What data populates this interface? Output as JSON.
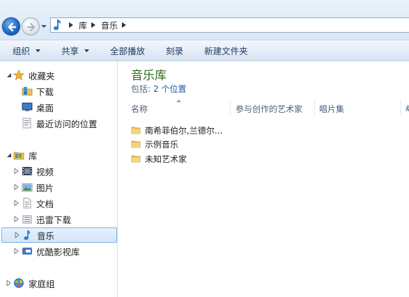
{
  "address": {
    "crumbs": [
      "库",
      "音乐"
    ]
  },
  "toolbar": {
    "organize": "组织",
    "share": "共享",
    "play_all": "全部播放",
    "burn": "刻录",
    "new_folder": "新建文件夹"
  },
  "nav": {
    "favorites": "收藏夹",
    "downloads": "下载",
    "desktop": "桌面",
    "recent": "最近访问的位置",
    "libraries": "库",
    "videos": "视频",
    "pictures": "图片",
    "documents": "文档",
    "thunder": "迅雷下载",
    "music": "音乐",
    "youku": "优酷影视库",
    "homegroup": "家庭组"
  },
  "content": {
    "title": "音乐库",
    "includes_label": "包括:",
    "includes_link": "2 个位置",
    "columns": {
      "name": "名称",
      "artists": "参与创作的艺术家",
      "album": "唱片集",
      "number": "#"
    },
    "items": [
      "南希菲伯尔,兰德尔...",
      "示例音乐",
      "未知艺术家"
    ]
  },
  "colors": {
    "title_green": "#2a6a1a",
    "link_blue": "#1a5aa6",
    "selection_border": "#84acdd"
  }
}
